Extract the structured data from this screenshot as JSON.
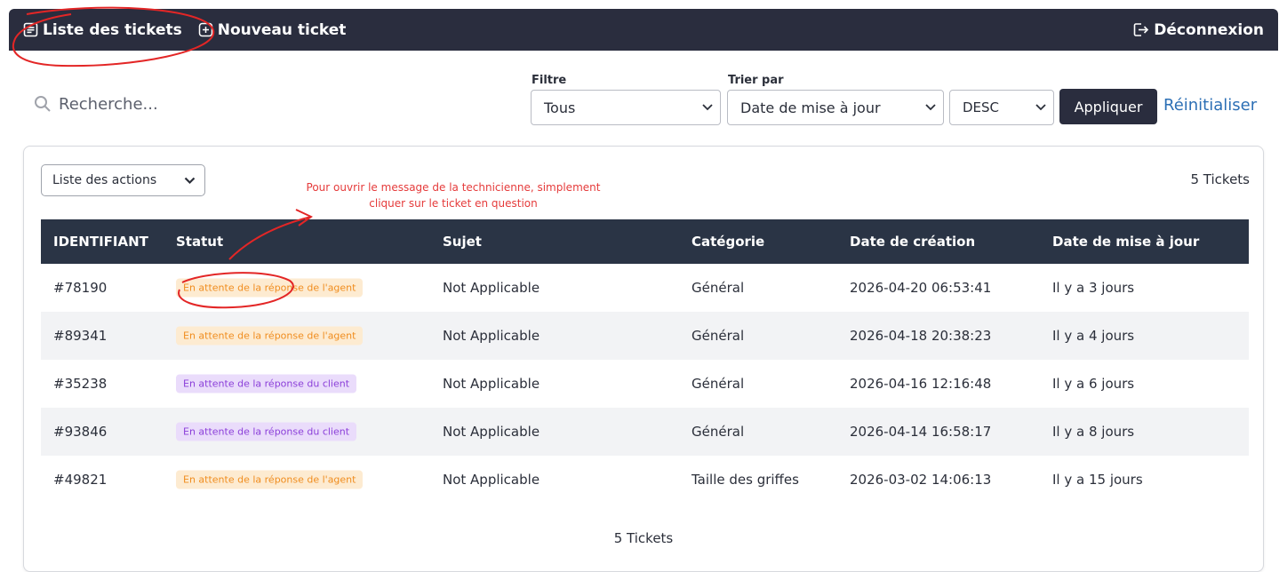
{
  "nav": {
    "tickets_list": "Liste des tickets",
    "new_ticket": "Nouveau ticket",
    "logout": "Déconnexion"
  },
  "search": {
    "placeholder": "Recherche..."
  },
  "filters": {
    "filter_label": "Filtre",
    "filter_value": "Tous",
    "sort_label": "Trier par",
    "sort_value": "Date de mise à jour",
    "order_value": "DESC",
    "apply": "Appliquer",
    "reset": "Réinitialiser"
  },
  "actions": {
    "label": "Liste des actions"
  },
  "annotation": {
    "line1": "Pour ouvrir le message de la technicienne, simplement",
    "line2": "cliquer sur le ticket en question"
  },
  "ticket_count": "5 Tickets",
  "table": {
    "headers": [
      "IDENTIFIANT",
      "Statut",
      "Sujet",
      "Catégorie",
      "Date de création",
      "Date de mise à jour"
    ],
    "rows": [
      {
        "id": "#78190",
        "status": "En attente de la réponse de l'agent",
        "status_type": "agent",
        "subject": "Not Applicable",
        "category": "Général",
        "created": "2026-04-20 06:53:41",
        "updated": "Il y a 3 jours"
      },
      {
        "id": "#89341",
        "status": "En attente de la réponse de l'agent",
        "status_type": "agent",
        "subject": "Not Applicable",
        "category": "Général",
        "created": "2026-04-18 20:38:23",
        "updated": "Il y a 4 jours"
      },
      {
        "id": "#35238",
        "status": "En attente de la réponse du client",
        "status_type": "client",
        "subject": "Not Applicable",
        "category": "Général",
        "created": "2026-04-16 12:16:48",
        "updated": "Il y a 6 jours"
      },
      {
        "id": "#93846",
        "status": "En attente de la réponse du client",
        "status_type": "client",
        "subject": "Not Applicable",
        "category": "Général",
        "created": "2026-04-14 16:58:17",
        "updated": "Il y a 8 jours"
      },
      {
        "id": "#49821",
        "status": "En attente de la réponse de l'agent",
        "status_type": "agent",
        "subject": "Not Applicable",
        "category": "Taille des griffes",
        "created": "2026-03-02 14:06:13",
        "updated": "Il y a 15 jours"
      }
    ]
  },
  "colors": {
    "nav_bg": "#2a2d3e",
    "table_header_bg": "#2a3445",
    "accent_link": "#2c6fb5",
    "annotation_red": "#e53b3b",
    "badge_agent_bg": "#fdebd1",
    "badge_agent_text": "#f08d1f",
    "badge_client_bg": "#eadcfb",
    "badge_client_text": "#8b3fd9"
  },
  "icons": [
    "list-icon",
    "plus-square-icon",
    "logout-icon",
    "search-icon",
    "chevron-down-icon"
  ]
}
